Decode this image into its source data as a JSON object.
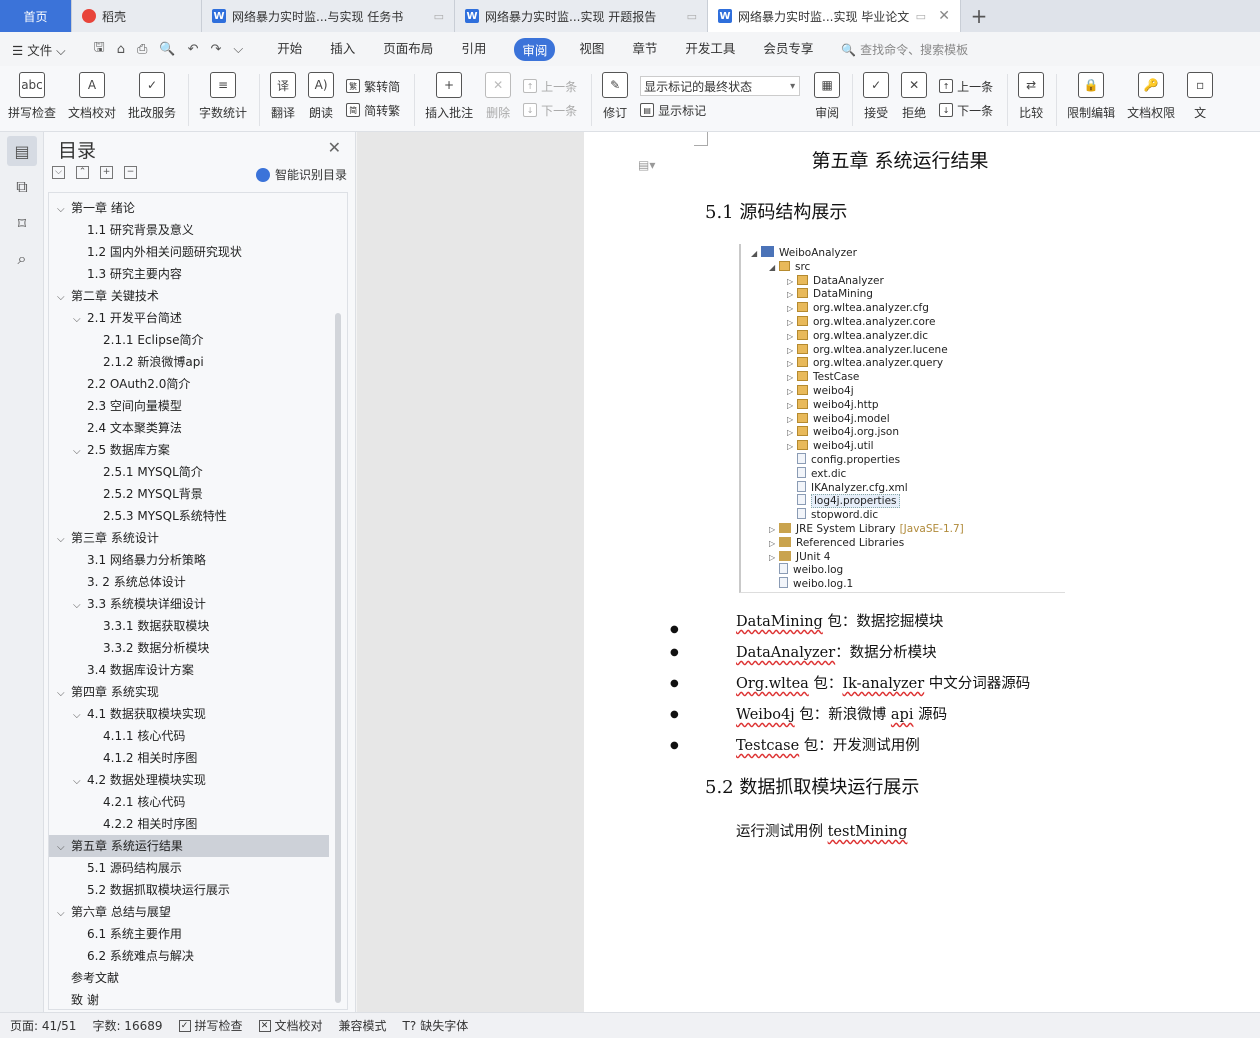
{
  "tabs": [
    {
      "label": "首页",
      "type": "home"
    },
    {
      "label": "稻壳",
      "type": "wps"
    },
    {
      "label": "网络暴力实时监...与实现 任务书",
      "type": "doc"
    },
    {
      "label": "网络暴力实时监...实现 开题报告",
      "type": "doc"
    },
    {
      "label": "网络暴力实时监...实现 毕业论文",
      "type": "doc",
      "active": true
    }
  ],
  "menu": {
    "file": "文件",
    "items": [
      "开始",
      "插入",
      "页面布局",
      "引用",
      "审阅",
      "视图",
      "章节",
      "开发工具",
      "会员专享"
    ],
    "active": "审阅",
    "search": "查找命令、搜索模板"
  },
  "ribbon": {
    "spellcheck": "拼写检查",
    "doccheck": "文档校对",
    "annotate_service": "批改服务",
    "wordcount": "字数统计",
    "translate": "翻译",
    "read": "朗读",
    "to_trad": "繁转简",
    "to_simp": "简转繁",
    "insert_comment": "插入批注",
    "delete": "删除",
    "prev_comment": "上一条",
    "next_comment": "下一条",
    "revise": "修订",
    "markup_select": "显示标记的最终状态",
    "show_markup": "显示标记",
    "review": "审阅",
    "accept": "接受",
    "reject": "拒绝",
    "prev": "上一条",
    "next": "下一条",
    "compare": "比较",
    "restrict": "限制编辑",
    "permission": "文档权限",
    "more": "文"
  },
  "toc": {
    "title": "目录",
    "smart": "智能识别目录",
    "items": [
      {
        "level": 0,
        "arrow": true,
        "text": "第一章 绪论"
      },
      {
        "level": 1,
        "text": "1.1 研究背景及意义"
      },
      {
        "level": 1,
        "text": "1.2 国内外相关问题研究现状"
      },
      {
        "level": 1,
        "text": "1.3 研究主要内容"
      },
      {
        "level": 0,
        "arrow": true,
        "text": "第二章 关键技术"
      },
      {
        "level": 1,
        "arrow": true,
        "text": "2.1 开发平台简述"
      },
      {
        "level": 2,
        "text": "2.1.1 Eclipse简介"
      },
      {
        "level": 2,
        "text": "2.1.2 新浪微博api"
      },
      {
        "level": 1,
        "text": "2.2 OAuth2.0简介"
      },
      {
        "level": 1,
        "text": "2.3 空间向量模型"
      },
      {
        "level": 1,
        "text": "2.4 文本聚类算法"
      },
      {
        "level": 1,
        "arrow": true,
        "text": "2.5 数据库方案"
      },
      {
        "level": 2,
        "text": "2.5.1 MYSQL简介"
      },
      {
        "level": 2,
        "text": "2.5.2 MYSQL背景"
      },
      {
        "level": 2,
        "text": "2.5.3 MYSQL系统特性"
      },
      {
        "level": 0,
        "arrow": true,
        "text": "第三章 系统设计"
      },
      {
        "level": 1,
        "text": "3.1 网络暴力分析策略"
      },
      {
        "level": 1,
        "text": "3. 2 系统总体设计"
      },
      {
        "level": 1,
        "arrow": true,
        "text": "3.3 系统模块详细设计"
      },
      {
        "level": 2,
        "text": "3.3.1 数据获取模块"
      },
      {
        "level": 2,
        "text": "3.3.2 数据分析模块"
      },
      {
        "level": 1,
        "text": "3.4 数据库设计方案"
      },
      {
        "level": 0,
        "arrow": true,
        "text": "第四章 系统实现"
      },
      {
        "level": 1,
        "arrow": true,
        "text": "4.1 数据获取模块实现"
      },
      {
        "level": 2,
        "text": "4.1.1 核心代码"
      },
      {
        "level": 2,
        "text": "4.1.2 相关时序图"
      },
      {
        "level": 1,
        "arrow": true,
        "text": "4.2 数据处理模块实现"
      },
      {
        "level": 2,
        "text": "4.2.1 核心代码"
      },
      {
        "level": 2,
        "text": "4.2.2 相关时序图"
      },
      {
        "level": 0,
        "arrow": true,
        "text": "第五章 系统运行结果",
        "selected": true
      },
      {
        "level": 1,
        "text": "5.1 源码结构展示"
      },
      {
        "level": 1,
        "text": "5.2 数据抓取模块运行展示"
      },
      {
        "level": 0,
        "arrow": true,
        "text": "第六章 总结与展望"
      },
      {
        "level": 1,
        "text": "6.1 系统主要作用"
      },
      {
        "level": 1,
        "text": "6.2 系统难点与解决"
      },
      {
        "level": 0,
        "text": "参考文献"
      },
      {
        "level": 0,
        "text": "致  谢"
      }
    ]
  },
  "document": {
    "chapter_title": "第五章 系统运行结果",
    "section1": "5.1 源码结构展示",
    "tree": [
      {
        "indent": 0,
        "expand": "◢",
        "icon": "proj",
        "text": "WeiboAnalyzer"
      },
      {
        "indent": 1,
        "expand": "◢",
        "icon": "pkg",
        "text": "src"
      },
      {
        "indent": 2,
        "expand": "▷",
        "icon": "pkg",
        "text": "DataAnalyzer"
      },
      {
        "indent": 2,
        "expand": "▷",
        "icon": "pkg",
        "text": "DataMining"
      },
      {
        "indent": 2,
        "expand": "▷",
        "icon": "pkg",
        "text": "org.wltea.analyzer.cfg"
      },
      {
        "indent": 2,
        "expand": "▷",
        "icon": "pkg",
        "text": "org.wltea.analyzer.core"
      },
      {
        "indent": 2,
        "expand": "▷",
        "icon": "pkg",
        "text": "org.wltea.analyzer.dic"
      },
      {
        "indent": 2,
        "expand": "▷",
        "icon": "pkg",
        "text": "org.wltea.analyzer.lucene"
      },
      {
        "indent": 2,
        "expand": "▷",
        "icon": "pkg",
        "text": "org.wltea.analyzer.query"
      },
      {
        "indent": 2,
        "expand": "▷",
        "icon": "pkg",
        "text": "TestCase"
      },
      {
        "indent": 2,
        "expand": "▷",
        "icon": "pkg",
        "text": "weibo4j"
      },
      {
        "indent": 2,
        "expand": "▷",
        "icon": "pkg",
        "text": "weibo4j.http"
      },
      {
        "indent": 2,
        "expand": "▷",
        "icon": "pkg",
        "text": "weibo4j.model"
      },
      {
        "indent": 2,
        "expand": "▷",
        "icon": "pkg",
        "text": "weibo4j.org.json"
      },
      {
        "indent": 2,
        "expand": "▷",
        "icon": "pkg",
        "text": "weibo4j.util"
      },
      {
        "indent": 2,
        "expand": "",
        "icon": "file",
        "text": "config.properties"
      },
      {
        "indent": 2,
        "expand": "",
        "icon": "file",
        "text": "ext.dic"
      },
      {
        "indent": 2,
        "expand": "",
        "icon": "file",
        "text": "IKAnalyzer.cfg.xml"
      },
      {
        "indent": 2,
        "expand": "",
        "icon": "file",
        "text": "log4j.properties",
        "highlight": true
      },
      {
        "indent": 2,
        "expand": "",
        "icon": "file",
        "text": "stopword.dic"
      },
      {
        "indent": 1,
        "expand": "▷",
        "icon": "lib",
        "text": "JRE System Library",
        "suffix": "[JavaSE-1.7]"
      },
      {
        "indent": 1,
        "expand": "▷",
        "icon": "lib",
        "text": "Referenced Libraries"
      },
      {
        "indent": 1,
        "expand": "▷",
        "icon": "lib",
        "text": "JUnit 4"
      },
      {
        "indent": 1,
        "expand": "",
        "icon": "file",
        "text": "weibo.log"
      },
      {
        "indent": 1,
        "expand": "",
        "icon": "file",
        "text": "weibo.log.1"
      }
    ],
    "bullets": [
      {
        "a": "DataMining",
        "b": " 包：数据挖掘模块"
      },
      {
        "a": "DataAnalyzer",
        "b": "：数据分析模块"
      },
      {
        "a": "Org.wltea",
        "b": " 包：",
        "c": "Ik-analyzer",
        "d": " 中文分词器源码"
      },
      {
        "a": "Weibo4j",
        "b": " 包：新浪微博 ",
        "c": "api",
        "d": " 源码"
      },
      {
        "a": "Testcase",
        "b": " 包：开发测试用例"
      }
    ],
    "section2": "5.2 数据抓取模块运行展示",
    "para_prefix": "运行测试用例 ",
    "para_code": "testMining"
  },
  "status": {
    "page": "页面: 41/51",
    "words": "字数: 16689",
    "spell": "拼写检查",
    "doccheck": "文档校对",
    "compat": "兼容模式",
    "missing_font": "缺失字体"
  },
  "colors": {
    "accent": "#3b73d9",
    "spell_underline": "#d33"
  }
}
